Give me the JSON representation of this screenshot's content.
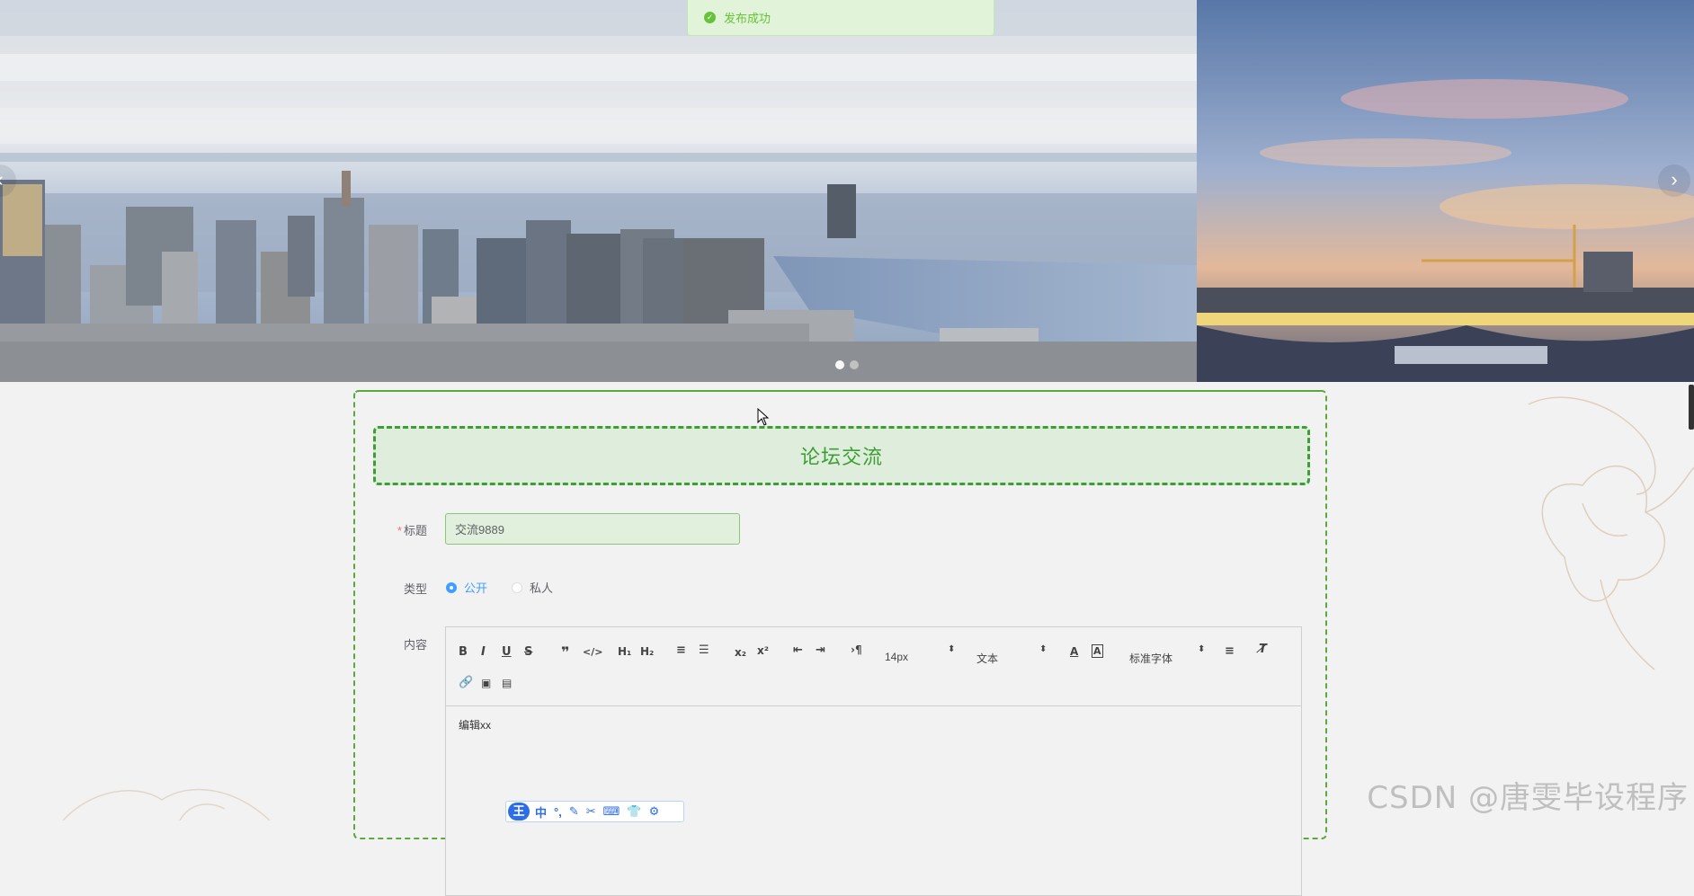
{
  "toast": {
    "message": "发布成功",
    "icon": "check-circle-icon"
  },
  "carousel": {
    "slides": [
      "city-skyline",
      "river-bridge-sunset"
    ],
    "prev_arrow": "‹",
    "next_arrow": "›",
    "active_index": 0
  },
  "form": {
    "heading": "论坛交流",
    "title_label": "标题",
    "title_value": "交流9889",
    "type_label": "类型",
    "type_options": [
      "公开",
      "私人"
    ],
    "type_selected": "公开",
    "content_label": "内容"
  },
  "editor": {
    "font_size": "14px",
    "header_select": "文本",
    "font_family": "标准字体",
    "content_text": "编辑xx",
    "buttons": [
      "bold",
      "italic",
      "underline",
      "strike",
      "blockquote",
      "code-block",
      "h1",
      "h2",
      "ordered-list",
      "bullet-list",
      "subscript",
      "superscript",
      "outdent",
      "indent",
      "text-direction",
      "font-color",
      "background-color",
      "align",
      "clean",
      "link",
      "image",
      "video"
    ]
  },
  "ime": {
    "logo": "王",
    "items": [
      "中",
      "°,",
      "✎",
      "✂",
      "⌨",
      "👕",
      "⚙"
    ]
  },
  "watermark": "CSDN @唐雯毕设程序",
  "colors": {
    "brand_green": "#3d9e35",
    "success": "#67c23a",
    "primary": "#409eff"
  }
}
